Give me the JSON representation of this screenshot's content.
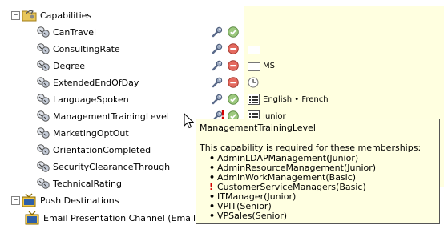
{
  "tree": {
    "capabilities_label": "Capabilities",
    "items": [
      {
        "label": "CanTravel",
        "status": "ok",
        "value": ""
      },
      {
        "label": "ConsultingRate",
        "status": "blocked",
        "value": ""
      },
      {
        "label": "Degree",
        "status": "blocked",
        "value": "MS"
      },
      {
        "label": "ExtendedEndOfDay",
        "status": "blocked",
        "value": ""
      },
      {
        "label": "LanguageSpoken",
        "status": "ok",
        "value": "English • French"
      },
      {
        "label": "ManagementTrainingLevel",
        "status": "ok",
        "value": "Junior"
      },
      {
        "label": "MarketingOptOut",
        "status": "",
        "value": ""
      },
      {
        "label": "OrientationCompleted",
        "status": "",
        "value": ""
      },
      {
        "label": "SecurityClearanceThrough",
        "status": "",
        "value": ""
      },
      {
        "label": "TechnicalRating",
        "status": "",
        "value": ""
      }
    ],
    "push_label": "Push Destinations",
    "push_item": "Email Presentation Channel (Email"
  },
  "tooltip": {
    "title": "ManagementTrainingLevel",
    "description": "This capability is required for these memberships:",
    "bullet_char": "•",
    "bang_char": "!",
    "memberships": [
      {
        "text": "AdminLDAPManagement(Junior)",
        "warn": false
      },
      {
        "text": "AdminResourceManagement(Junior)",
        "warn": false
      },
      {
        "text": "AdminWorkManagement(Basic)",
        "warn": false
      },
      {
        "text": "CustomerServiceManagers(Basic)",
        "warn": true
      },
      {
        "text": "ITManager(Junior)",
        "warn": false
      },
      {
        "text": "VPIT(Senior)",
        "warn": false
      },
      {
        "text": "VPSales(Senior)",
        "warn": false
      }
    ]
  },
  "colors": {
    "panel_bg": "#ffffe0",
    "tooltip_bg": "#ffffe1",
    "ok": "#8fbf6f",
    "blocked": "#d9534f",
    "warn": "#d40000"
  }
}
